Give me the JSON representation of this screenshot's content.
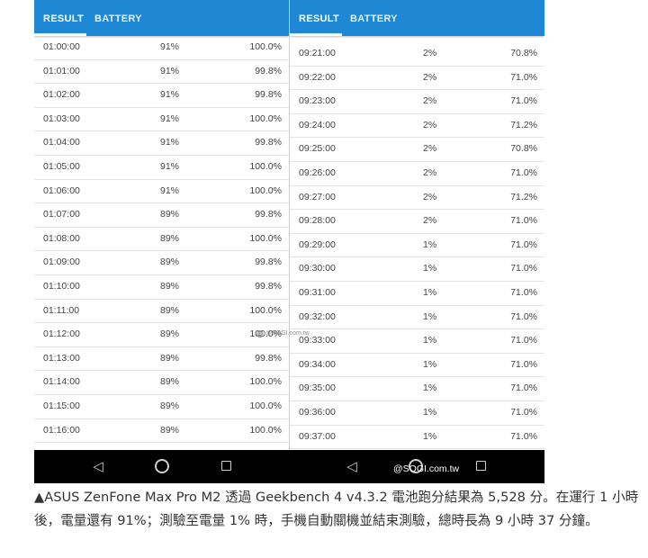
{
  "tabs": {
    "result": "RESULT",
    "battery": "BATTERY"
  },
  "left_rows": [
    [
      "01:00:00",
      "91%",
      "100.0%"
    ],
    [
      "01:01:00",
      "91%",
      "99.8%"
    ],
    [
      "01:02:00",
      "91%",
      "99.8%"
    ],
    [
      "01:03:00",
      "91%",
      "100.0%"
    ],
    [
      "01:04:00",
      "91%",
      "99.8%"
    ],
    [
      "01:05:00",
      "91%",
      "100.0%"
    ],
    [
      "01:06:00",
      "91%",
      "100.0%"
    ],
    [
      "01:07:00",
      "89%",
      "99.8%"
    ],
    [
      "01:08:00",
      "89%",
      "100.0%"
    ],
    [
      "01:09:00",
      "89%",
      "99.8%"
    ],
    [
      "01:10:00",
      "89%",
      "99.8%"
    ],
    [
      "01:11:00",
      "89%",
      "100.0%"
    ],
    [
      "01:12:00",
      "89%",
      "100.0%"
    ],
    [
      "01:13:00",
      "89%",
      "99.8%"
    ],
    [
      "01:14:00",
      "89%",
      "100.0%"
    ],
    [
      "01:15:00",
      "89%",
      "100.0%"
    ],
    [
      "01:16:00",
      "89%",
      "100.0%"
    ]
  ],
  "right_rows": [
    [
      "09:21:00",
      "2%",
      "70.8%"
    ],
    [
      "09:22:00",
      "2%",
      "71.0%"
    ],
    [
      "09:23:00",
      "2%",
      "71.0%"
    ],
    [
      "09:24:00",
      "2%",
      "71.2%"
    ],
    [
      "09:25:00",
      "2%",
      "70.8%"
    ],
    [
      "09:26:00",
      "2%",
      "71.0%"
    ],
    [
      "09:27:00",
      "2%",
      "71.2%"
    ],
    [
      "09:28:00",
      "2%",
      "71.0%"
    ],
    [
      "09:29:00",
      "1%",
      "71.0%"
    ],
    [
      "09:30:00",
      "1%",
      "71.0%"
    ],
    [
      "09:31:00",
      "1%",
      "71.0%"
    ],
    [
      "09:32:00",
      "1%",
      "71.0%"
    ],
    [
      "09:33:00",
      "1%",
      "71.0%"
    ],
    [
      "09:34:00",
      "1%",
      "71.0%"
    ],
    [
      "09:35:00",
      "1%",
      "71.0%"
    ],
    [
      "09:36:00",
      "1%",
      "71.0%"
    ],
    [
      "09:37:00",
      "1%",
      "71.0%"
    ]
  ],
  "nav": {
    "back_glyph": "◁",
    "watermark": "@SOGI.com.tw"
  },
  "watermark_mid": {
    "line1": "sogi",
    "line2": "@SOGI.com.tw"
  },
  "caption": "▲ASUS ZenFone Max Pro M2 透過 Geekbench 4 v4.3.2 電池跑分結果為 5,528 分。在運行 1 小時後，電量還有 91%；測驗至電量 1% 時，手機自動關機並結束測驗，總時長為 9 小時 37 分鐘。",
  "colors": {
    "appbar": "#1e88d4",
    "navbar": "#000000"
  }
}
